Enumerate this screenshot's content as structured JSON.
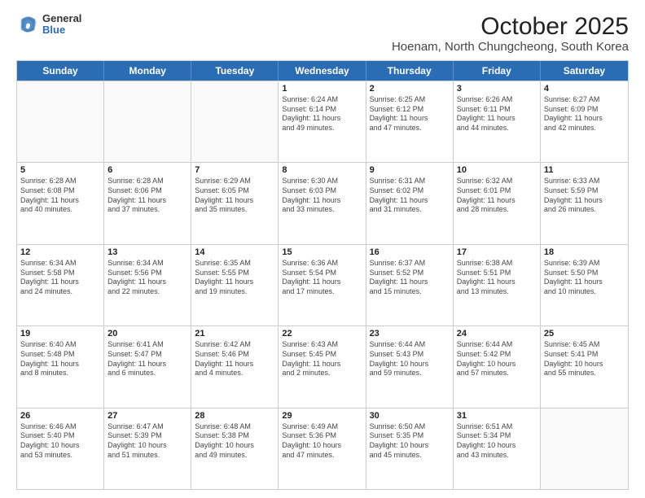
{
  "logo": {
    "general": "General",
    "blue": "Blue"
  },
  "title": "October 2025",
  "subtitle": "Hoenam, North Chungcheong, South Korea",
  "header_days": [
    "Sunday",
    "Monday",
    "Tuesday",
    "Wednesday",
    "Thursday",
    "Friday",
    "Saturday"
  ],
  "weeks": [
    [
      {
        "day": "",
        "info": ""
      },
      {
        "day": "",
        "info": ""
      },
      {
        "day": "",
        "info": ""
      },
      {
        "day": "1",
        "info": "Sunrise: 6:24 AM\nSunset: 6:14 PM\nDaylight: 11 hours\nand 49 minutes."
      },
      {
        "day": "2",
        "info": "Sunrise: 6:25 AM\nSunset: 6:12 PM\nDaylight: 11 hours\nand 47 minutes."
      },
      {
        "day": "3",
        "info": "Sunrise: 6:26 AM\nSunset: 6:11 PM\nDaylight: 11 hours\nand 44 minutes."
      },
      {
        "day": "4",
        "info": "Sunrise: 6:27 AM\nSunset: 6:09 PM\nDaylight: 11 hours\nand 42 minutes."
      }
    ],
    [
      {
        "day": "5",
        "info": "Sunrise: 6:28 AM\nSunset: 6:08 PM\nDaylight: 11 hours\nand 40 minutes."
      },
      {
        "day": "6",
        "info": "Sunrise: 6:28 AM\nSunset: 6:06 PM\nDaylight: 11 hours\nand 37 minutes."
      },
      {
        "day": "7",
        "info": "Sunrise: 6:29 AM\nSunset: 6:05 PM\nDaylight: 11 hours\nand 35 minutes."
      },
      {
        "day": "8",
        "info": "Sunrise: 6:30 AM\nSunset: 6:03 PM\nDaylight: 11 hours\nand 33 minutes."
      },
      {
        "day": "9",
        "info": "Sunrise: 6:31 AM\nSunset: 6:02 PM\nDaylight: 11 hours\nand 31 minutes."
      },
      {
        "day": "10",
        "info": "Sunrise: 6:32 AM\nSunset: 6:01 PM\nDaylight: 11 hours\nand 28 minutes."
      },
      {
        "day": "11",
        "info": "Sunrise: 6:33 AM\nSunset: 5:59 PM\nDaylight: 11 hours\nand 26 minutes."
      }
    ],
    [
      {
        "day": "12",
        "info": "Sunrise: 6:34 AM\nSunset: 5:58 PM\nDaylight: 11 hours\nand 24 minutes."
      },
      {
        "day": "13",
        "info": "Sunrise: 6:34 AM\nSunset: 5:56 PM\nDaylight: 11 hours\nand 22 minutes."
      },
      {
        "day": "14",
        "info": "Sunrise: 6:35 AM\nSunset: 5:55 PM\nDaylight: 11 hours\nand 19 minutes."
      },
      {
        "day": "15",
        "info": "Sunrise: 6:36 AM\nSunset: 5:54 PM\nDaylight: 11 hours\nand 17 minutes."
      },
      {
        "day": "16",
        "info": "Sunrise: 6:37 AM\nSunset: 5:52 PM\nDaylight: 11 hours\nand 15 minutes."
      },
      {
        "day": "17",
        "info": "Sunrise: 6:38 AM\nSunset: 5:51 PM\nDaylight: 11 hours\nand 13 minutes."
      },
      {
        "day": "18",
        "info": "Sunrise: 6:39 AM\nSunset: 5:50 PM\nDaylight: 11 hours\nand 10 minutes."
      }
    ],
    [
      {
        "day": "19",
        "info": "Sunrise: 6:40 AM\nSunset: 5:48 PM\nDaylight: 11 hours\nand 8 minutes."
      },
      {
        "day": "20",
        "info": "Sunrise: 6:41 AM\nSunset: 5:47 PM\nDaylight: 11 hours\nand 6 minutes."
      },
      {
        "day": "21",
        "info": "Sunrise: 6:42 AM\nSunset: 5:46 PM\nDaylight: 11 hours\nand 4 minutes."
      },
      {
        "day": "22",
        "info": "Sunrise: 6:43 AM\nSunset: 5:45 PM\nDaylight: 11 hours\nand 2 minutes."
      },
      {
        "day": "23",
        "info": "Sunrise: 6:44 AM\nSunset: 5:43 PM\nDaylight: 10 hours\nand 59 minutes."
      },
      {
        "day": "24",
        "info": "Sunrise: 6:44 AM\nSunset: 5:42 PM\nDaylight: 10 hours\nand 57 minutes."
      },
      {
        "day": "25",
        "info": "Sunrise: 6:45 AM\nSunset: 5:41 PM\nDaylight: 10 hours\nand 55 minutes."
      }
    ],
    [
      {
        "day": "26",
        "info": "Sunrise: 6:46 AM\nSunset: 5:40 PM\nDaylight: 10 hours\nand 53 minutes."
      },
      {
        "day": "27",
        "info": "Sunrise: 6:47 AM\nSunset: 5:39 PM\nDaylight: 10 hours\nand 51 minutes."
      },
      {
        "day": "28",
        "info": "Sunrise: 6:48 AM\nSunset: 5:38 PM\nDaylight: 10 hours\nand 49 minutes."
      },
      {
        "day": "29",
        "info": "Sunrise: 6:49 AM\nSunset: 5:36 PM\nDaylight: 10 hours\nand 47 minutes."
      },
      {
        "day": "30",
        "info": "Sunrise: 6:50 AM\nSunset: 5:35 PM\nDaylight: 10 hours\nand 45 minutes."
      },
      {
        "day": "31",
        "info": "Sunrise: 6:51 AM\nSunset: 5:34 PM\nDaylight: 10 hours\nand 43 minutes."
      },
      {
        "day": "",
        "info": ""
      }
    ]
  ]
}
